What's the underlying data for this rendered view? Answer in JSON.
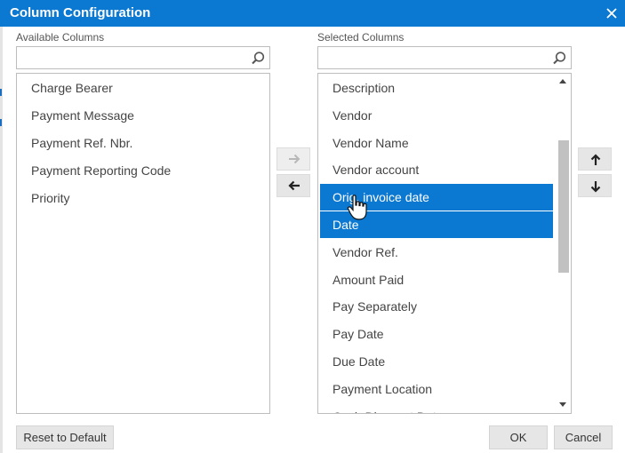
{
  "dialog": {
    "title": "Column Configuration"
  },
  "available": {
    "label": "Available Columns",
    "search_value": "",
    "items": [
      "Charge Bearer",
      "Payment Message",
      "Payment Ref. Nbr.",
      "Payment Reporting Code",
      "Priority"
    ]
  },
  "selected": {
    "label": "Selected Columns",
    "search_value": "",
    "items": [
      {
        "label": "Description",
        "selected": false
      },
      {
        "label": "Vendor",
        "selected": false
      },
      {
        "label": "Vendor Name",
        "selected": false
      },
      {
        "label": "Vendor account",
        "selected": false
      },
      {
        "label": "Orig. invoice date",
        "selected": true
      },
      {
        "label": "Date",
        "selected": true
      },
      {
        "label": "Vendor Ref.",
        "selected": false
      },
      {
        "label": "Amount Paid",
        "selected": false
      },
      {
        "label": "Pay Separately",
        "selected": false
      },
      {
        "label": "Pay Date",
        "selected": false
      },
      {
        "label": "Due Date",
        "selected": false
      },
      {
        "label": "Payment Location",
        "selected": false
      },
      {
        "label": "Cash Discount Date",
        "selected": false
      }
    ]
  },
  "buttons": {
    "reset": "Reset to Default",
    "ok": "OK",
    "cancel": "Cancel"
  },
  "colors": {
    "accent": "#0b78d1",
    "button_bg": "#e6e6e6"
  }
}
